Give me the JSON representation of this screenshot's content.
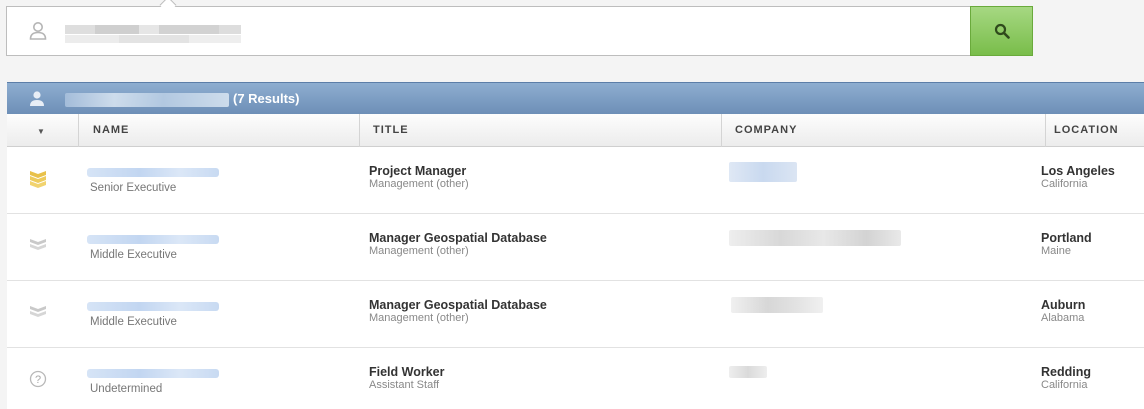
{
  "search": {
    "placeholder": "",
    "value": ""
  },
  "results": {
    "count_label": "(7 Results)"
  },
  "columns": [
    "NAME",
    "TITLE",
    "COMPANY",
    "LOCATION"
  ],
  "rows": [
    {
      "level": "Senior Executive",
      "level_icon": "senior-executive-icon",
      "title": "Project Manager",
      "title_category": "Management (other)",
      "city": "Los Angeles",
      "state": "California"
    },
    {
      "level": "Middle Executive",
      "level_icon": "middle-executive-icon",
      "title": "Manager Geospatial Database",
      "title_category": "Management (other)",
      "city": "Portland",
      "state": "Maine"
    },
    {
      "level": "Middle Executive",
      "level_icon": "middle-executive-icon",
      "title": "Manager Geospatial Database",
      "title_category": "Management (other)",
      "city": "Auburn",
      "state": "Alabama"
    },
    {
      "level": "Undetermined",
      "level_icon": "question-icon",
      "title": "Field Worker",
      "title_category": "Assistant Staff",
      "city": "Redding",
      "state": "California"
    }
  ],
  "colors": {
    "search_button": "#79bd4a",
    "results_header": "#7a9bc2",
    "senior_icon": "#e8c14a",
    "middle_icon": "#c4c4c4"
  }
}
